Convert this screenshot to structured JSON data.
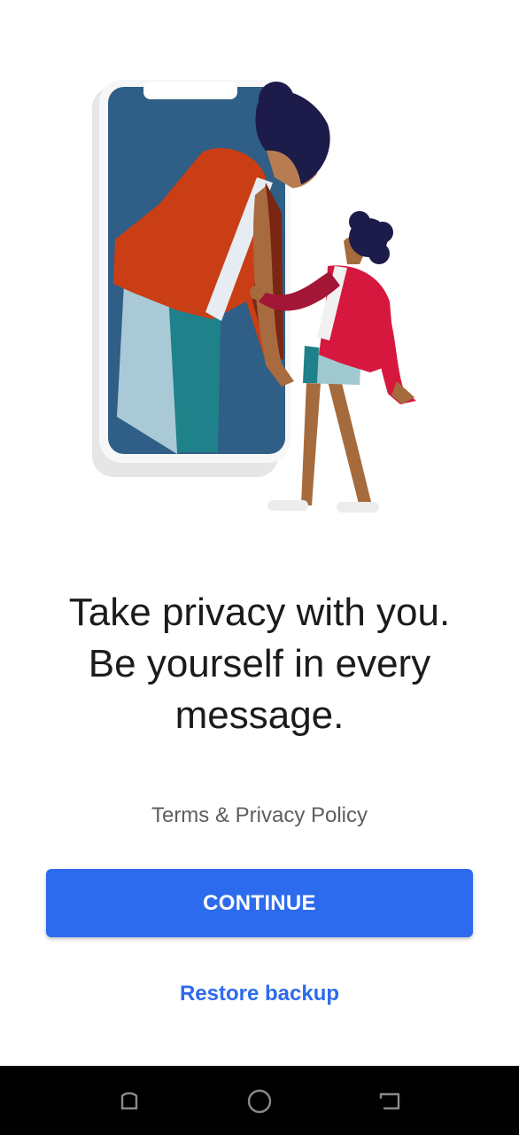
{
  "headline": {
    "line1": "Take privacy with you.",
    "line2": "Be yourself in every",
    "line3": "message."
  },
  "terms_link": "Terms & Privacy Policy",
  "continue_button": "CONTINUE",
  "restore_link": "Restore backup",
  "navbar": {
    "buttons": [
      "recents-icon",
      "home-icon",
      "back-icon"
    ]
  },
  "colors": {
    "accent": "#2c6bed",
    "headline": "#1b1b1b",
    "muted_text": "#5e5e5e",
    "navbar": "#000000"
  }
}
